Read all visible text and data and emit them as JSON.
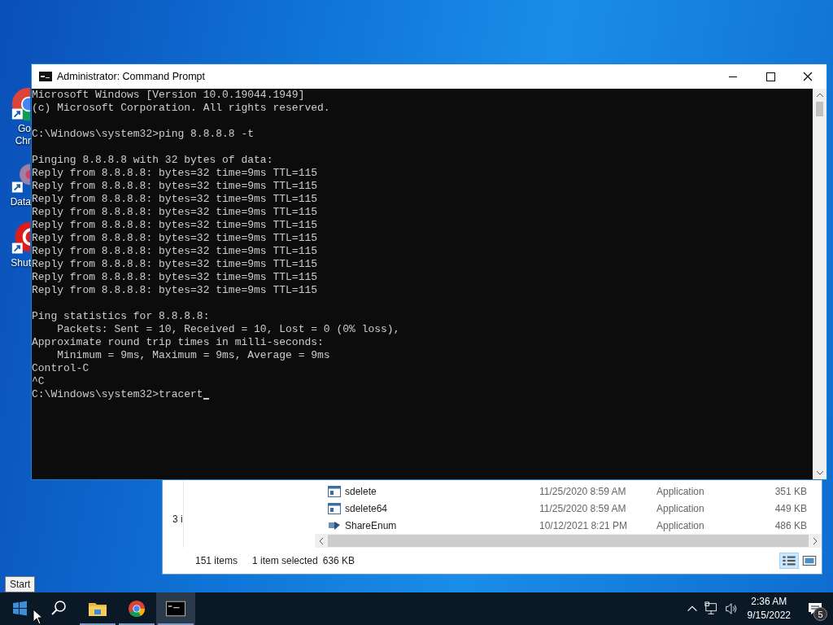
{
  "desktop_icons": [
    {
      "kind": "chrome",
      "lines": [
        "Go",
        "Chr"
      ]
    },
    {
      "kind": "dataw",
      "lines": [
        "Data"
      ]
    },
    {
      "kind": "shutdown",
      "lines": [
        "Shut"
      ]
    }
  ],
  "explorer": {
    "side_text": "3 i",
    "rows": [
      {
        "name": "sdelete",
        "date": "11/25/2020 8:59 AM",
        "type": "Application",
        "size": "351 KB",
        "kind": "app"
      },
      {
        "name": "sdelete64",
        "date": "11/25/2020 8:59 AM",
        "type": "Application",
        "size": "449 KB",
        "kind": "app"
      },
      {
        "name": "ShareEnum",
        "date": "10/12/2021 8:21 PM",
        "type": "Application",
        "size": "486 KB",
        "kind": "share"
      }
    ],
    "status": {
      "items": "151 items",
      "selected": "1 item selected",
      "selected_size": "636 KB"
    }
  },
  "console": {
    "title": "Administrator: Command Prompt",
    "blocks": [
      [
        "Microsoft Windows [Version 10.0.19044.1949]",
        "(c) Microsoft Corporation. All rights reserved."
      ],
      [
        "C:\\Windows\\system32>ping 8.8.8.8 -t"
      ],
      [
        "Pinging 8.8.8.8 with 32 bytes of data:",
        "Reply from 8.8.8.8: bytes=32 time=9ms TTL=115",
        "Reply from 8.8.8.8: bytes=32 time=9ms TTL=115",
        "Reply from 8.8.8.8: bytes=32 time=9ms TTL=115",
        "Reply from 8.8.8.8: bytes=32 time=9ms TTL=115",
        "Reply from 8.8.8.8: bytes=32 time=9ms TTL=115",
        "Reply from 8.8.8.8: bytes=32 time=9ms TTL=115",
        "Reply from 8.8.8.8: bytes=32 time=9ms TTL=115",
        "Reply from 8.8.8.8: bytes=32 time=9ms TTL=115",
        "Reply from 8.8.8.8: bytes=32 time=9ms TTL=115",
        "Reply from 8.8.8.8: bytes=32 time=9ms TTL=115"
      ],
      [
        "Ping statistics for 8.8.8.8:",
        "    Packets: Sent = 10, Received = 10, Lost = 0 (0% loss),",
        "Approximate round trip times in milli-seconds:",
        "    Minimum = 9ms, Maximum = 9ms, Average = 9ms",
        "Control-C",
        "^C",
        "C:\\Windows\\system32>tracert"
      ]
    ]
  },
  "tooltip": "Start",
  "taskbar": {
    "apps": [
      {
        "kind": "explorer",
        "selected": false
      },
      {
        "kind": "chrome",
        "selected": false
      },
      {
        "kind": "cmd",
        "selected": true
      }
    ],
    "time": "2:36 AM",
    "date": "9/15/2022",
    "notifications": "5"
  }
}
